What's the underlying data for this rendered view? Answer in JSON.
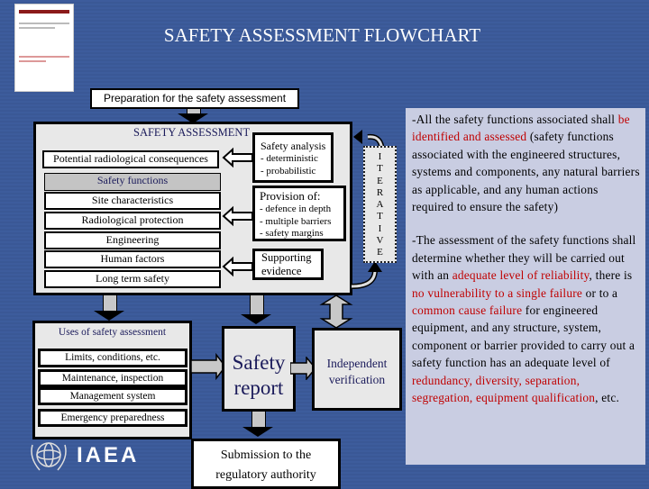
{
  "title": "SAFETY ASSESSMENT FLOWCHART",
  "preparation": "Preparation for the safety assessment",
  "assessment": {
    "heading": "SAFETY ASSESSMENT",
    "left_items": [
      "Potential radiological consequences",
      "Safety functions",
      "Site characteristics",
      "Radiological protection",
      "Engineering",
      "Human factors",
      "Long term safety"
    ],
    "safety_analysis": {
      "title": "Safety analysis",
      "items": [
        "- deterministic",
        "- probabilistic"
      ]
    },
    "provision": {
      "title": "Provision of:",
      "items": [
        "- defence in depth",
        "- multiple barriers",
        "- safety margins"
      ]
    },
    "supporting": [
      "Supporting",
      "evidence"
    ]
  },
  "iterative": [
    "I",
    "T",
    "E",
    "R",
    "A",
    "T",
    "I",
    "V",
    "E"
  ],
  "uses": {
    "heading": "Uses of safety assessment",
    "items": [
      "Limits, conditions, etc.",
      "Maintenance, inspection",
      "Management system",
      "Emergency preparedness"
    ]
  },
  "safety_report": [
    "Safety",
    "report"
  ],
  "independent": [
    "Independent",
    "verification"
  ],
  "submission": [
    "Submission to the",
    "regulatory authority"
  ],
  "logo_text": "IAEA",
  "notes": {
    "p1": [
      {
        "t": "-All the safety functions associated shall "
      },
      {
        "t": "be identified and assessed",
        "red": true
      },
      {
        "t": " (safety functions associated with the engineered structures, systems and components, any natural barriers as applicable, and any human actions required to ensure the safety)"
      }
    ],
    "p2": [
      {
        "t": "-The assessment of the safety functions shall determine whether they will be carried out with an "
      },
      {
        "t": "adequate level of reliability",
        "red": true
      },
      {
        "t": ", there is "
      },
      {
        "t": "no vulnerability to a single failure",
        "red": true
      },
      {
        "t": " or to a "
      },
      {
        "t": "common cause failure",
        "red": true
      },
      {
        "t": " for engineered equipment, and any structure, system, component or barrier provided to carry out a safety function has an adequate level of "
      },
      {
        "t": "redundancy, diversity, separation, segregation, equipment qualification",
        "red": true
      },
      {
        "t": ", etc."
      }
    ]
  },
  "colors": {
    "background": "#3a5896",
    "panel": "#c9cde2",
    "highlight": "#c00000",
    "box_fill": "#e8e8e8"
  }
}
